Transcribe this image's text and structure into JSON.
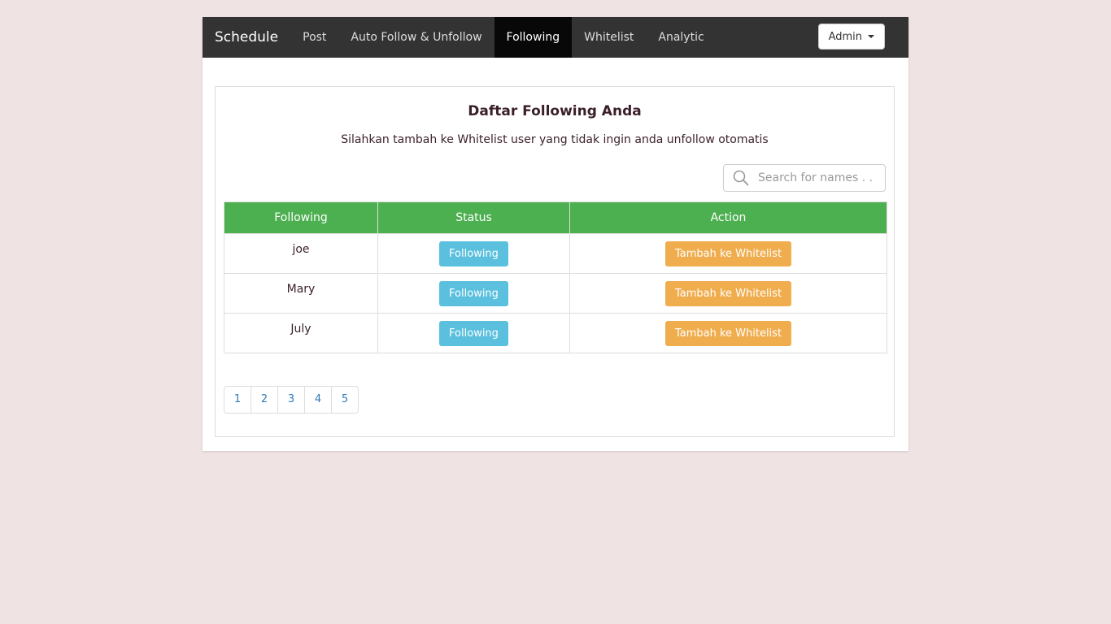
{
  "navbar": {
    "brand": "Schedule",
    "items": [
      {
        "label": "Post"
      },
      {
        "label": "Auto Follow & Unfollow"
      },
      {
        "label": "Following"
      },
      {
        "label": "Whitelist"
      },
      {
        "label": "Analytic"
      }
    ],
    "active_item": "Following",
    "admin_label": "Admin",
    "colors": {
      "background": "#333333",
      "active": "#080808"
    }
  },
  "main": {
    "title": "Daftar Following Anda",
    "subtitle": "Silahkan tambah ke Whitelist user yang tidak ingin anda unfollow otomatis",
    "search": {
      "placeholder": "Search for names . .",
      "value": ""
    },
    "table": {
      "headers": [
        "Following",
        "Status",
        "Action"
      ],
      "header_color": "#4caf50",
      "rows": [
        {
          "name": "joe",
          "status": "Following",
          "action": "Tambah ke Whitelist"
        },
        {
          "name": "Mary",
          "status": "Following",
          "action": "Tambah ke Whitelist"
        },
        {
          "name": "July",
          "status": "Following",
          "action": "Tambah ke Whitelist"
        }
      ],
      "status_color": "#5bc0de",
      "action_color": "#f0ad4e"
    },
    "pagination": [
      "1",
      "2",
      "3",
      "4",
      "5"
    ]
  }
}
